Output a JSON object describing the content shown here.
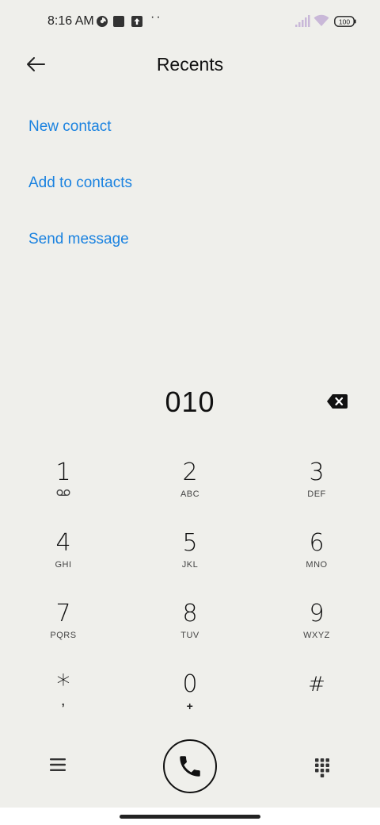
{
  "status_bar": {
    "time": "8:16 AM",
    "battery": "100",
    "icons": [
      "data-saver-icon",
      "square-notification-icon",
      "upload-icon",
      "more-dots-icon",
      "signal-icon",
      "wifi-icon",
      "battery-icon"
    ]
  },
  "header": {
    "title": "Recents",
    "back_icon": "arrow-left-icon"
  },
  "actions": [
    {
      "label": "New contact"
    },
    {
      "label": "Add to contacts"
    },
    {
      "label": "Send message"
    }
  ],
  "dialer": {
    "number": "010",
    "backspace_icon": "backspace-icon"
  },
  "keypad": [
    {
      "digit": "1",
      "letters": "",
      "sub_icon": "voicemail-icon"
    },
    {
      "digit": "2",
      "letters": "ABC"
    },
    {
      "digit": "3",
      "letters": "DEF"
    },
    {
      "digit": "4",
      "letters": "GHI"
    },
    {
      "digit": "5",
      "letters": "JKL"
    },
    {
      "digit": "6",
      "letters": "MNO"
    },
    {
      "digit": "7",
      "letters": "PQRS"
    },
    {
      "digit": "8",
      "letters": "TUV"
    },
    {
      "digit": "9",
      "letters": "WXYZ"
    },
    {
      "digit": "*",
      "letters": ","
    },
    {
      "digit": "0",
      "letters": "+"
    },
    {
      "digit": "#",
      "letters": ""
    }
  ],
  "bottom_bar": {
    "menu_icon": "hamburger-menu-icon",
    "call_icon": "phone-icon",
    "dialpad_icon": "dialpad-grid-icon"
  },
  "colors": {
    "background": "#efefeb",
    "accent": "#1a82e0",
    "text": "#111111"
  }
}
